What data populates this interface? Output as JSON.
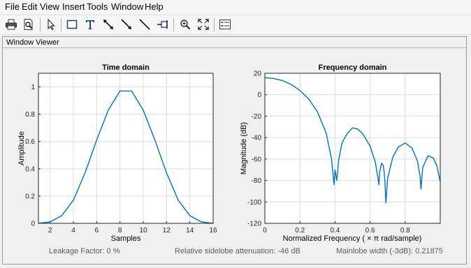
{
  "menu": {
    "items": [
      "File",
      "Edit",
      "View",
      "Insert",
      "Tools",
      "Window",
      "Help"
    ]
  },
  "toolbar": {
    "buttons": [
      {
        "name": "print-icon"
      },
      {
        "name": "print-preview-icon"
      },
      {
        "name": "select-arrow-icon"
      },
      {
        "name": "insert-rectangle-icon"
      },
      {
        "name": "insert-text-icon"
      },
      {
        "name": "insert-double-arrow-icon"
      },
      {
        "name": "insert-arrow-icon"
      },
      {
        "name": "insert-line-icon"
      },
      {
        "name": "pin-icon"
      },
      {
        "name": "zoom-in-icon"
      },
      {
        "name": "fit-view-icon"
      },
      {
        "name": "legend-icon"
      }
    ]
  },
  "panel": {
    "title": "Window Viewer"
  },
  "status": {
    "leakage": "Leakage Factor: 0 %",
    "sidelobe": "Relative sidelobe attenuation: -46 dB",
    "mainlobe": "Mainlobe width (-3dB): 0.21875"
  },
  "colors": {
    "line": "#0072bd",
    "grid": "#dcdcdc",
    "axes": "#262626"
  },
  "chart_data": [
    {
      "type": "line",
      "title": "Time domain",
      "xlabel": "Samples",
      "ylabel": "Amplitude",
      "xlim": [
        1,
        16
      ],
      "ylim": [
        0,
        1.1
      ],
      "grid": true,
      "xticks": [
        2,
        4,
        6,
        8,
        10,
        12,
        14,
        16
      ],
      "yticks": [
        0,
        0.2,
        0.4,
        0.6,
        0.8,
        1
      ],
      "xtick_labels": [
        "2",
        "4",
        "6",
        "8",
        "10",
        "12",
        "14",
        "16"
      ],
      "ytick_labels": [
        "0",
        "0.2",
        "0.4",
        "0.6",
        "0.8",
        "1"
      ],
      "x": [
        1,
        2,
        3,
        4,
        5,
        6,
        7,
        8,
        9,
        10,
        11,
        12,
        13,
        14,
        15,
        16
      ],
      "y": [
        0.0,
        0.01,
        0.056,
        0.17,
        0.37,
        0.61,
        0.83,
        0.97,
        0.97,
        0.83,
        0.61,
        0.37,
        0.17,
        0.056,
        0.01,
        0.0
      ]
    },
    {
      "type": "line",
      "title": "Frequency domain",
      "xlabel": "Normalized  Frequency    ( × π  rad/sample)",
      "ylabel": "Magnitude (dB)",
      "xlim": [
        0,
        1
      ],
      "ylim": [
        -120,
        20
      ],
      "grid": true,
      "xticks": [
        0,
        0.2,
        0.4,
        0.6,
        0.8
      ],
      "yticks": [
        20,
        0,
        -20,
        -40,
        -60,
        -80,
        -100,
        -120
      ],
      "xtick_labels": [
        "0",
        "0.2",
        "0.4",
        "0.6",
        "0.8"
      ],
      "ytick_labels": [
        "20",
        "0",
        "-20",
        "-40",
        "-60",
        "-80",
        "-100",
        "-120"
      ],
      "x": [
        0,
        0.05,
        0.1,
        0.15,
        0.2,
        0.25,
        0.3,
        0.35,
        0.38,
        0.395,
        0.4,
        0.405,
        0.41,
        0.415,
        0.42,
        0.44,
        0.47,
        0.5,
        0.53,
        0.56,
        0.6,
        0.63,
        0.645,
        0.65,
        0.655,
        0.665,
        0.675,
        0.68,
        0.685,
        0.69,
        0.7,
        0.73,
        0.76,
        0.8,
        0.84,
        0.87,
        0.885,
        0.89,
        0.9,
        0.93,
        0.96,
        0.98,
        1.0
      ],
      "y": [
        15.8,
        15.2,
        13.2,
        9.6,
        4.0,
        -4.0,
        -16.0,
        -36.0,
        -60.0,
        -84.0,
        -70.0,
        -75.0,
        -80.0,
        -72.0,
        -62.0,
        -45.0,
        -36.0,
        -31.0,
        -32.0,
        -37.0,
        -48.0,
        -63.0,
        -78.0,
        -84.0,
        -72.0,
        -64.0,
        -66.0,
        -72.0,
        -82.0,
        -101.0,
        -78.0,
        -58.0,
        -49.0,
        -45.0,
        -50.0,
        -62.0,
        -76.0,
        -88.0,
        -68.0,
        -57.0,
        -59.0,
        -66.0,
        -81.0
      ]
    }
  ]
}
